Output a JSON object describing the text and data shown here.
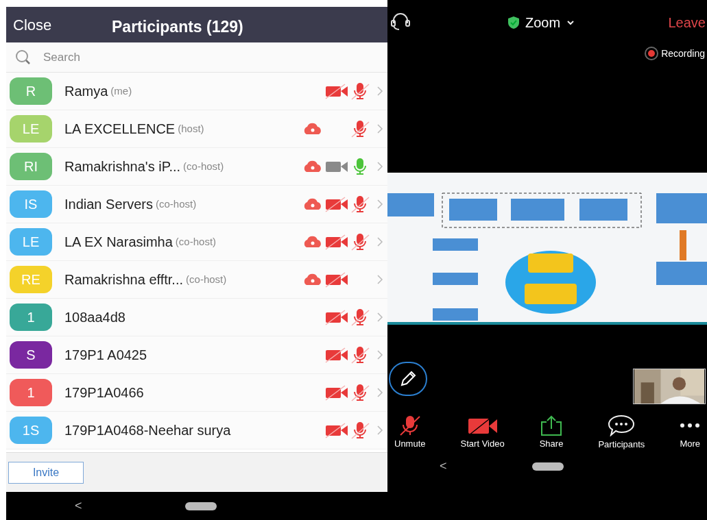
{
  "participants_panel": {
    "close": "Close",
    "title": "Participants (129)",
    "search": {
      "placeholder": "Search"
    },
    "participants": [
      {
        "initials": "R",
        "color": "#6dbf75",
        "name": "Ramya",
        "role": "(me)",
        "cloud": false,
        "video_muted": true,
        "audio_muted": true
      },
      {
        "initials": "LE",
        "color": "#a6d46c",
        "name": "LA EXCELLENCE",
        "role": "(host)",
        "cloud": true,
        "audio_muted": true
      },
      {
        "initials": "RI",
        "color": "#6dbf75",
        "name": "Ramakrishna's iP...",
        "role": "(co-host)",
        "cloud": true,
        "video_muted": false,
        "audio_muted": false
      },
      {
        "initials": "IS",
        "color": "#4db6ee",
        "name": "Indian Servers",
        "role": "(co-host)",
        "cloud": true,
        "video_muted": true,
        "audio_muted": true
      },
      {
        "initials": "LE",
        "color": "#4db6ee",
        "name": "LA EX Narasimha",
        "role": "(co-host)",
        "cloud": true,
        "video_muted": true,
        "audio_muted": true
      },
      {
        "initials": "RE",
        "color": "#f4d22a",
        "name": "Ramakrishna efftr...",
        "role": "(co-host)",
        "cloud": true,
        "video_muted": true
      },
      {
        "initials": "1",
        "color": "#38a898",
        "name": "108aa4d8",
        "cloud": false,
        "video_muted": true,
        "audio_muted": true
      },
      {
        "initials": "S",
        "color": "#7a28a0",
        "name": "179P1 A0425",
        "cloud": false,
        "video_muted": true,
        "audio_muted": true
      },
      {
        "initials": "1",
        "color": "#f05a5a",
        "name": "179P1A0466",
        "cloud": false,
        "video_muted": true,
        "audio_muted": true
      },
      {
        "initials": "1S",
        "color": "#4db6ee",
        "name": "179P1A0468-Neehar surya",
        "cloud": false,
        "video_muted": true,
        "audio_muted": true
      }
    ],
    "invite": "Invite"
  },
  "meeting": {
    "title": "Zoom",
    "leave": "Leave",
    "recording": "Recording",
    "toolbar": [
      {
        "kind": "mic",
        "label": "Unmute"
      },
      {
        "kind": "video",
        "label": "Start Video"
      },
      {
        "kind": "share",
        "label": "Share"
      },
      {
        "kind": "chat",
        "label": "Participants"
      },
      {
        "kind": "more",
        "label": "More"
      }
    ]
  },
  "nav_bars": [
    {
      "back": "<"
    },
    {
      "back": "<"
    }
  ]
}
